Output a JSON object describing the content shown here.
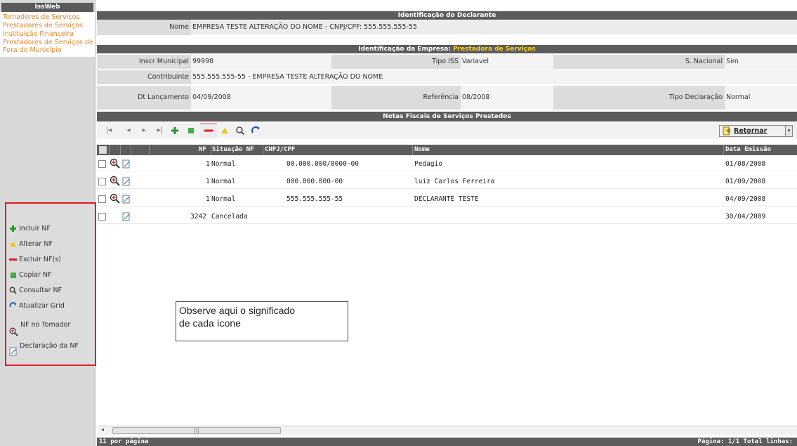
{
  "sidebar": {
    "brand": "IssWeb",
    "links": [
      "Tomadores de Serviços",
      "Prestadores de Serviços",
      "Instituição Financeira",
      "Prestadores de Serviços de Fora do Município"
    ]
  },
  "legend": {
    "items": [
      {
        "icon": "plus-icon",
        "label": "Incluir NF"
      },
      {
        "icon": "triangle-icon",
        "label": "Alterar NF"
      },
      {
        "icon": "minus-icon",
        "label": "Excluir NF(s)"
      },
      {
        "icon": "square-icon",
        "label": "Copiar NF"
      },
      {
        "icon": "magnifier-icon",
        "label": "Consultar NF"
      },
      {
        "icon": "refresh-icon",
        "label": "Atualizar Grid"
      },
      {
        "icon": "zoom-nf-icon",
        "label": "NF no Tomador"
      },
      {
        "icon": "document-edit-icon",
        "label": "Declaração da NF"
      }
    ]
  },
  "declarante": {
    "title": "Identificação do Declarante",
    "nome_label": "Nome",
    "nome_value": "EMPRESA TESTE ALTERAÇÃO DO NOME - CNPJ/CPF: 555.555.555-55"
  },
  "empresa": {
    "title_prefix": "Identificação da Empresa:",
    "title_highlight": "Prestadora de Serviços",
    "insc_label": "Inscr Municipal",
    "insc_value": "99998",
    "tipo_iss_label": "Tipo ISS",
    "tipo_iss_value": "Variavel",
    "snacional_label": "S. Nacional",
    "snacional_value": "Sim",
    "contribuinte_label": "Contribuinte",
    "contribuinte_value": "555.555.555-55 - EMPRESA TESTE ALTERAÇÃO DO NOME",
    "dt_label": "Dt Lançamento",
    "dt_value": "04/09/2008",
    "ref_label": "Referência",
    "ref_value": "08/2008",
    "tipo_decl_label": "Tipo Declaração",
    "tipo_decl_value": "Normal"
  },
  "notas": {
    "title": "Notas Fiscais de Serviços Prestados",
    "retornar": "Retornar",
    "columns": [
      "NF",
      "Situação NF",
      "CNPJ/CPF",
      "Nome",
      "Data Emissão"
    ],
    "rows": [
      {
        "nf": "1",
        "situacao": "Normal",
        "cnpj": "00.000.000/0000-00",
        "nome": "Pedagio",
        "data": "01/08/2008",
        "zoom": true
      },
      {
        "nf": "1",
        "situacao": "Normal",
        "cnpj": "000.000.000-00",
        "nome": "luiz Carlos Ferreira",
        "data": "01/09/2008",
        "zoom": true
      },
      {
        "nf": "1",
        "situacao": "Normal",
        "cnpj": "555.555.555-55",
        "nome": "DECLARANTE TESTE",
        "data": "04/09/2008",
        "zoom": true
      },
      {
        "nf": "3242",
        "situacao": "Cancelada",
        "cnpj": "",
        "nome": "",
        "data": "30/04/2009",
        "zoom": false
      }
    ]
  },
  "callout": {
    "line1": "Observe aqui o significado",
    "line2": "de cada ícone"
  },
  "footer": {
    "left": "11 por página",
    "right": "Página: 1/1 Total linhas:"
  },
  "colors": {
    "header_bar": "#5c5c5c",
    "link": "#e2862c",
    "legend_border": "#e11b22",
    "highlight": "#f7d31a"
  }
}
